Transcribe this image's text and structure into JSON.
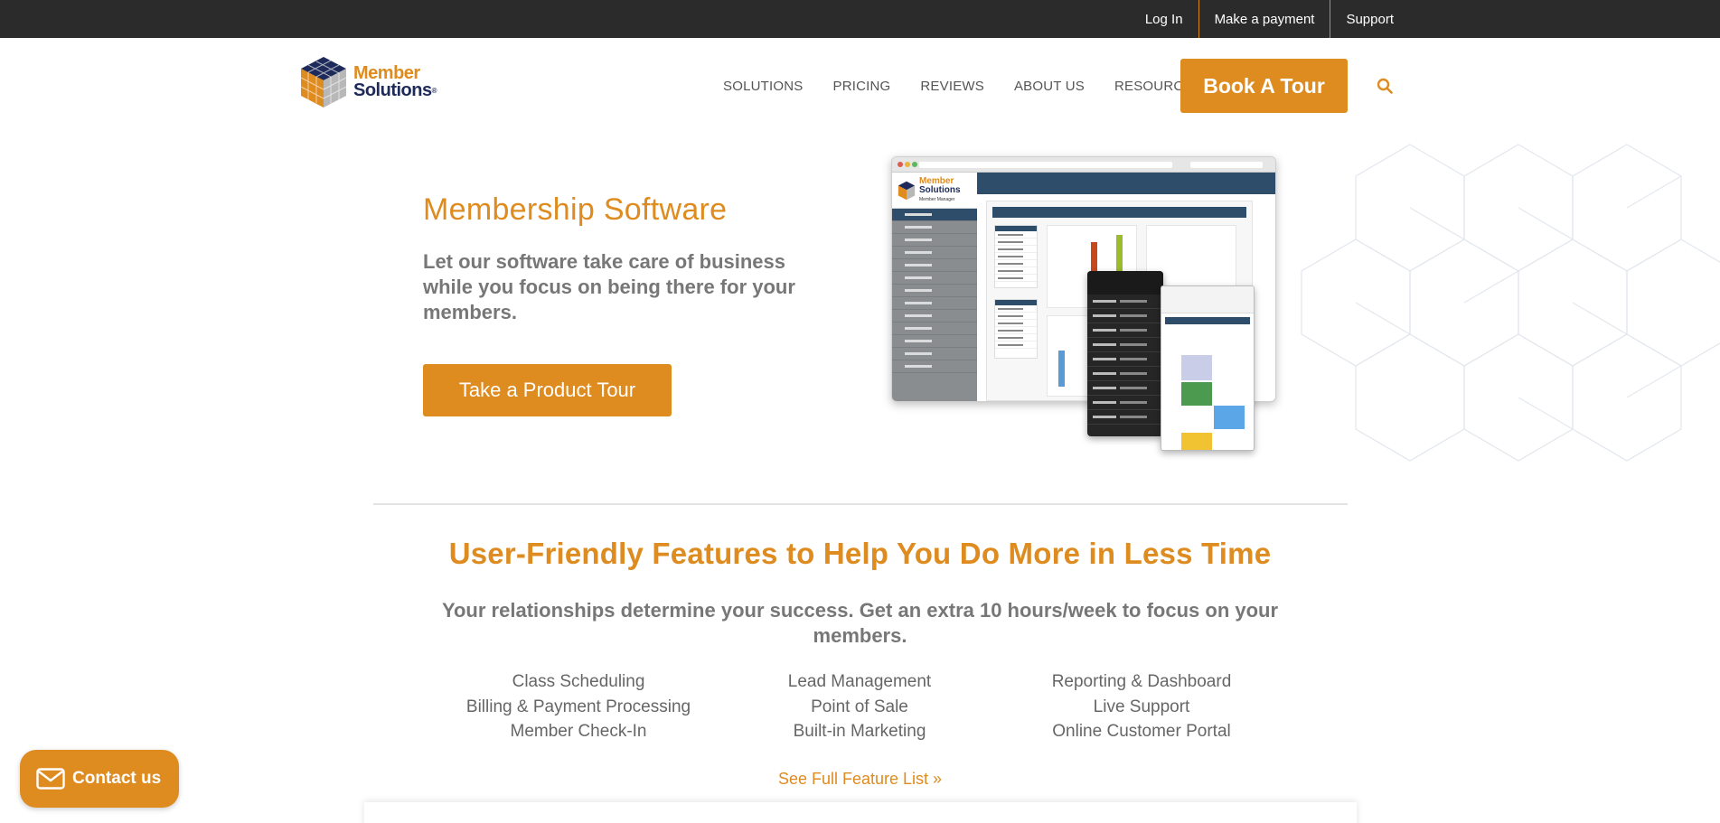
{
  "topbar": {
    "links": [
      "Log In",
      "Make a payment",
      "Support"
    ]
  },
  "logo": {
    "line1": "Member",
    "line2": "Solutions",
    "reg": "®",
    "icon": "cube-logo-icon"
  },
  "nav": {
    "items": [
      "SOLUTIONS",
      "PRICING",
      "REVIEWS",
      "ABOUT US",
      "RESOURCES"
    ],
    "book_label": "Book A Tour",
    "search_icon": "search-icon"
  },
  "hero": {
    "title": "Membership Software",
    "subtitle": "Let our software take care of business while you focus on being there for your members.",
    "cta_label": "Take a Product Tour"
  },
  "mockup": {
    "brand_line1": "Member",
    "brand_line2": "Solutions",
    "brand_line3": "Member Manager"
  },
  "features": {
    "title": "User-Friendly Features to Help You Do More in Less Time",
    "subtitle": "Your relationships determine your success. Get an extra 10 hours/week to focus on your members.",
    "columns": [
      [
        "Class Scheduling",
        "Billing & Payment Processing",
        "Member Check-In"
      ],
      [
        "Lead Management",
        "Point of Sale",
        "Built-in Marketing"
      ],
      [
        "Reporting & Dashboard",
        "Live Support",
        "Online Customer Portal"
      ]
    ],
    "full_list_label": "See Full Feature List »"
  },
  "contact": {
    "label": "Contact us",
    "icon": "envelope-icon"
  },
  "colors": {
    "accent": "#de8b1f",
    "topbar": "#2b2b2b",
    "navy": "#1e2b5a"
  }
}
